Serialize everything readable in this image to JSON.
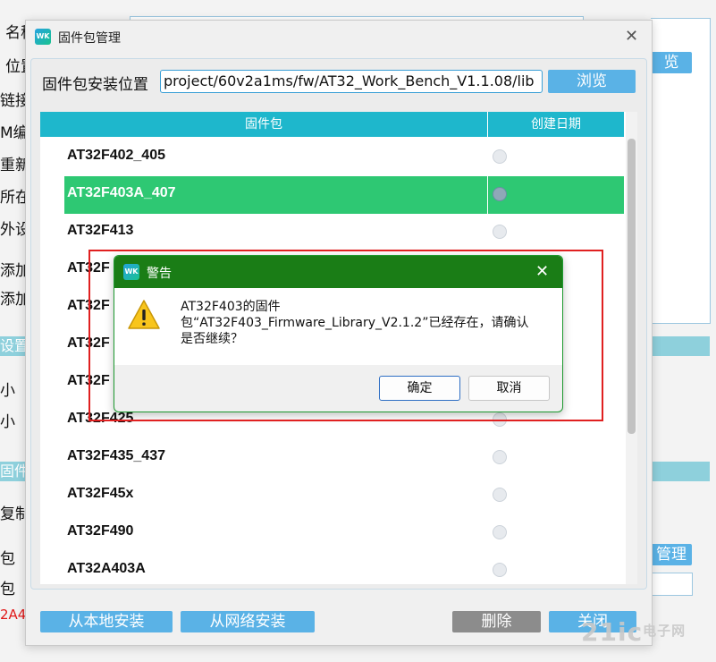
{
  "background": {
    "labels": [
      "名称",
      "位置",
      "链接",
      "M编",
      "重新",
      "所在",
      "外设",
      "添加",
      "添加"
    ],
    "sections": [
      "设置",
      "固件"
    ],
    "more_labels": [
      "小",
      "小",
      "复制",
      "包",
      "包",
      "2A4"
    ],
    "browse_label": "览",
    "manage_label": "管理"
  },
  "fw_dialog": {
    "title": "固件包管理",
    "logo_text": "WK",
    "close_icon": "close-icon",
    "path_label": "固件包安装位置",
    "path_value": "project/60v2a1ms/fw/AT32_Work_Bench_V1.1.08/lib",
    "browse_button": "浏览",
    "table": {
      "columns": [
        "固件包",
        "创建日期"
      ],
      "rows": [
        {
          "name": "AT32F402_405",
          "selected": false
        },
        {
          "name": "AT32F403A_407",
          "selected": true
        },
        {
          "name": "AT32F413",
          "selected": false
        },
        {
          "name": "AT32F",
          "selected": false
        },
        {
          "name": "AT32F",
          "selected": false
        },
        {
          "name": "AT32F",
          "selected": false
        },
        {
          "name": "AT32F",
          "selected": false
        },
        {
          "name": "AT32F425",
          "selected": false
        },
        {
          "name": "AT32F435_437",
          "selected": false
        },
        {
          "name": "AT32F45x",
          "selected": false
        },
        {
          "name": "AT32F490",
          "selected": false
        },
        {
          "name": "AT32A403A",
          "selected": false
        }
      ]
    },
    "buttons": {
      "install_local": "从本地安装",
      "install_network": "从网络安装",
      "delete": "删除",
      "close": "关闭"
    },
    "colors": {
      "header": "#1eb7cc",
      "selected_row": "#2ec873",
      "button": "#5ab2e6",
      "disabled_button": "#8c8c8c"
    }
  },
  "warning_dialog": {
    "title": "警告",
    "logo_text": "WK",
    "icon": "warning-icon",
    "message_lines": [
      "AT32F403的固件",
      "包“AT32F403_Firmware_Library_V2.1.2”已经存在，请确认",
      "是否继续？"
    ],
    "ok_button": "确定",
    "cancel_button": "取消",
    "colors": {
      "titlebar": "#1a7d16"
    }
  },
  "watermark": {
    "main": "21ic",
    "sub": "电子网"
  }
}
